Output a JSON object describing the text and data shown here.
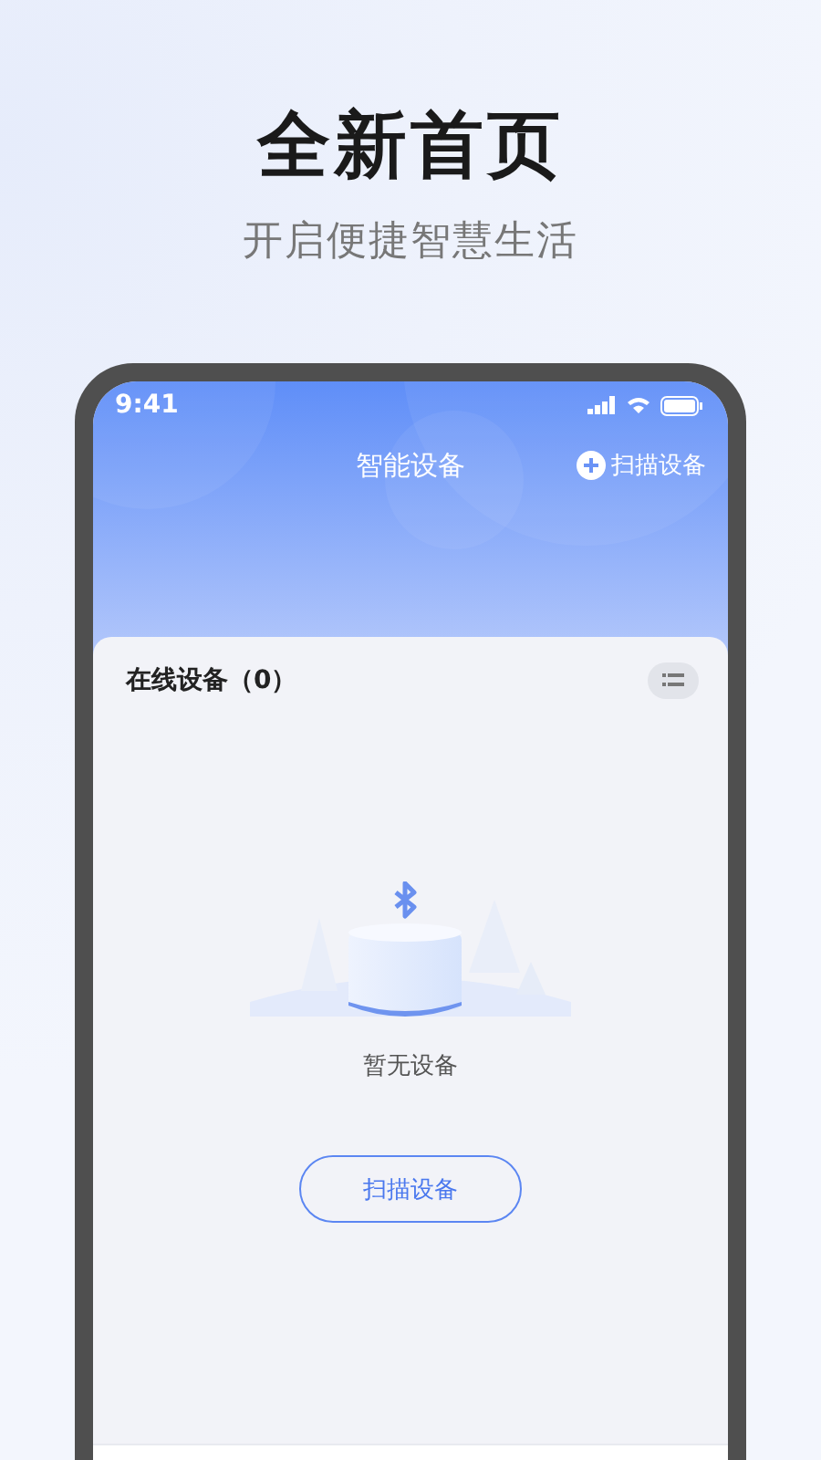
{
  "headline": "全新首页",
  "tagline": "开启便捷智慧生活",
  "status_bar": {
    "time": "9:41"
  },
  "header": {
    "title": "智能设备",
    "action": "扫描设备"
  },
  "section": {
    "title": "在线设备（0）"
  },
  "empty_state": {
    "message": "暂无设备",
    "button": "扫描设备"
  }
}
